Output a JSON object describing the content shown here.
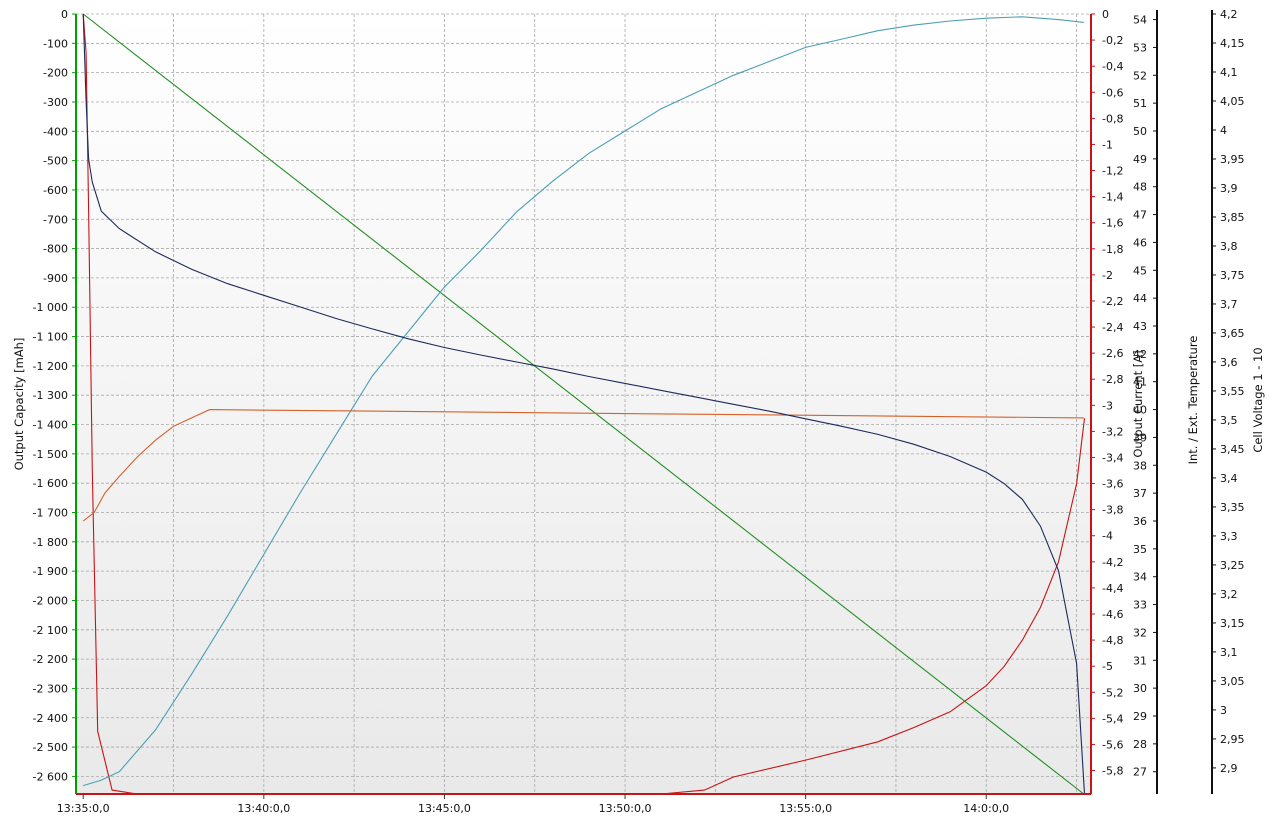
{
  "chart_data": {
    "type": "line",
    "grid": true,
    "legend": "none",
    "x_axis": {
      "ticks": [
        "13:35:0,0",
        "13:40:0,0",
        "13:45:0,0",
        "13:50:0,0",
        "13:55:0,0",
        "14:0:0,0"
      ],
      "range_minutes": [
        -0.2,
        27.9
      ]
    },
    "axes": {
      "capacity": {
        "label": "Output Capacity [mAh]",
        "range": [
          -2660,
          0
        ],
        "color": "#00a000",
        "ticks": [
          "0",
          "-100",
          "-200",
          "-300",
          "-400",
          "-500",
          "-600",
          "-700",
          "-800",
          "-900",
          "-1 000",
          "-1 100",
          "-1 200",
          "-1 300",
          "-1 400",
          "-1 500",
          "-1 600",
          "-1 700",
          "-1 800",
          "-1 900",
          "-2 000",
          "-2 100",
          "-2 200",
          "-2 300",
          "-2 400",
          "-2 500",
          "-2 600"
        ]
      },
      "current": {
        "label": "Output Current [A]",
        "range": [
          -5.98,
          0
        ],
        "color": "#c81414",
        "ticks": [
          "0",
          "-0,2",
          "-0,4",
          "-0,6",
          "-0,8",
          "-1",
          "-1,2",
          "-1,4",
          "-1,6",
          "-1,8",
          "-2",
          "-2,2",
          "-2,4",
          "-2,6",
          "-2,8",
          "-3",
          "-3,2",
          "-3,4",
          "-3,6",
          "-3,8",
          "-4",
          "-4,2",
          "-4,4",
          "-4,6",
          "-4,8",
          "-5",
          "-5,2",
          "-5,4",
          "-5,6",
          "-5,8"
        ]
      },
      "temperature": {
        "label": "Int. / Ext. Temperature",
        "range": [
          26.2,
          54.2
        ],
        "color": "#111111",
        "ticks": [
          "54",
          "53",
          "52",
          "51",
          "50",
          "49",
          "48",
          "47",
          "46",
          "45",
          "44",
          "43",
          "42",
          "41",
          "40",
          "39",
          "38",
          "37",
          "36",
          "35",
          "34",
          "33",
          "32",
          "31",
          "30",
          "29",
          "28",
          "27"
        ]
      },
      "cell_voltage": {
        "label": "Cell Voltage 1 - 10",
        "range": [
          2.855,
          4.2
        ],
        "color": "#111111",
        "ticks": [
          "4,2",
          "4,15",
          "4,1",
          "4,05",
          "4",
          "3,95",
          "3,9",
          "3,85",
          "3,8",
          "3,75",
          "3,7",
          "3,65",
          "3,6",
          "3,55",
          "3,5",
          "3,45",
          "3,4",
          "3,35",
          "3,3",
          "3,25",
          "3,2",
          "3,15",
          "3,1",
          "3,05",
          "3",
          "2,95",
          "2,9"
        ]
      }
    },
    "series": [
      {
        "axis": "capacity",
        "color": "#1f8f1f",
        "x": [
          0.0,
          27.7
        ],
        "y": [
          0,
          -2660
        ]
      },
      {
        "axis": "current",
        "color": "#c81414",
        "x": [
          0.0,
          0.08,
          0.15,
          0.25,
          0.4,
          0.8,
          1.5,
          3,
          9,
          16,
          17.2,
          18,
          20,
          22,
          23,
          24,
          25,
          25.5,
          26,
          26.5,
          27,
          27.5,
          27.72
        ],
        "y": [
          0,
          -0.3,
          -1.5,
          -3.5,
          -5.5,
          -5.95,
          -6.05,
          -6.1,
          -6.1,
          -6.1,
          -5.95,
          -5.85,
          -5.72,
          -5.58,
          -5.47,
          -5.35,
          -5.15,
          -5.0,
          -4.8,
          -4.55,
          -4.2,
          -3.6,
          -3.1
        ]
      },
      {
        "axis": "temperature",
        "color": "#4a9fb5",
        "x": [
          0.0,
          0.5,
          1.0,
          2,
          3,
          4,
          5,
          6,
          7,
          8,
          9,
          10,
          11,
          12,
          13,
          14,
          15,
          16,
          17,
          18,
          19,
          20,
          21,
          22,
          23,
          24,
          25,
          26,
          27,
          27.7
        ],
        "y": [
          26.5,
          26.7,
          27.0,
          28.5,
          30.5,
          32.6,
          34.8,
          37.0,
          39.1,
          41.2,
          42.8,
          44.4,
          45.7,
          47.1,
          48.2,
          49.2,
          50.0,
          50.8,
          51.4,
          52.0,
          52.5,
          53.0,
          53.3,
          53.6,
          53.8,
          53.95,
          54.05,
          54.1,
          54.0,
          53.9
        ]
      },
      {
        "axis": "temperature",
        "color": "#d4622a",
        "x": [
          0.0,
          0.3,
          0.6,
          1.0,
          1.5,
          2.0,
          2.5,
          3.0,
          3.5,
          27.7
        ],
        "y": [
          36.0,
          36.3,
          37.0,
          37.6,
          38.3,
          38.9,
          39.4,
          39.7,
          40.0,
          39.7
        ]
      },
      {
        "axis": "cell_voltage",
        "color": "#1d2a5c",
        "x": [
          0.0,
          0.08,
          0.15,
          0.25,
          0.5,
          1,
          2,
          3,
          4,
          5,
          6,
          7,
          8,
          9,
          10,
          11,
          12,
          13,
          14,
          15,
          16,
          17,
          18,
          19,
          20,
          21,
          22,
          23,
          24,
          25,
          25.5,
          26,
          26.5,
          27,
          27.5,
          27.72
        ],
        "y": [
          4.2,
          4.05,
          3.95,
          3.91,
          3.86,
          3.83,
          3.79,
          3.76,
          3.735,
          3.715,
          3.695,
          3.675,
          3.657,
          3.64,
          3.625,
          3.612,
          3.6,
          3.588,
          3.575,
          3.563,
          3.551,
          3.539,
          3.527,
          3.515,
          3.502,
          3.489,
          3.475,
          3.458,
          3.437,
          3.41,
          3.39,
          3.363,
          3.317,
          3.24,
          3.08,
          2.855
        ]
      }
    ]
  }
}
